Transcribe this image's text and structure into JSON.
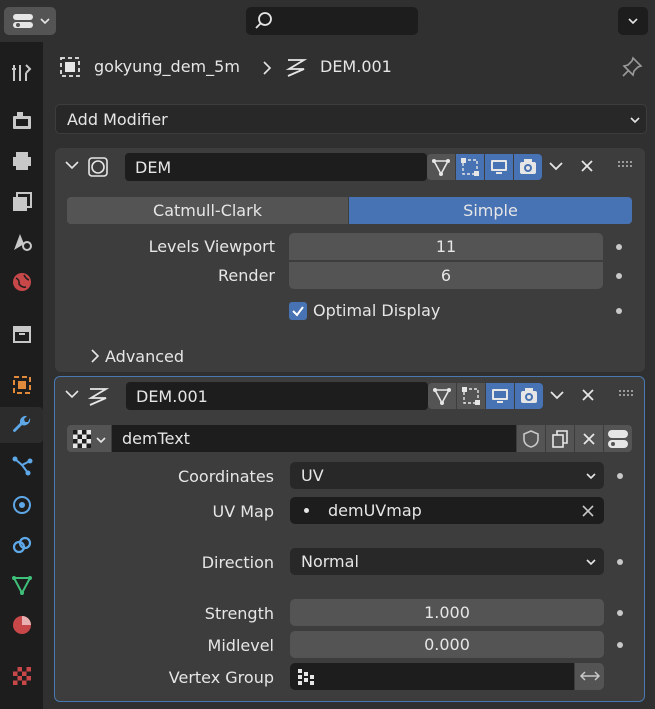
{
  "breadcrumb": {
    "object": "gokyung_dem_5m",
    "modifier": "DEM.001"
  },
  "add_modifier": {
    "label": "Add Modifier"
  },
  "modifiers": [
    {
      "name": "DEM",
      "algorithm": {
        "options": [
          "Catmull-Clark",
          "Simple"
        ],
        "selected": "Simple"
      },
      "levels_viewport": {
        "label": "Levels Viewport",
        "value": "11"
      },
      "render": {
        "label": "Render",
        "value": "6"
      },
      "optimal_display": {
        "label": "Optimal Display",
        "checked": true
      },
      "advanced": {
        "label": "Advanced"
      }
    },
    {
      "name": "DEM.001",
      "texture": {
        "name": "demText"
      },
      "coordinates": {
        "label": "Coordinates",
        "value": "UV"
      },
      "uv_map": {
        "label": "UV Map",
        "value": "demUVmap"
      },
      "direction": {
        "label": "Direction",
        "value": "Normal"
      },
      "strength": {
        "label": "Strength",
        "value": "1.000"
      },
      "midlevel": {
        "label": "Midlevel",
        "value": "0.000"
      },
      "vertex_group": {
        "label": "Vertex Group",
        "value": ""
      }
    }
  ],
  "colors": {
    "accent": "#4772b3",
    "panel": "#3d3d3d",
    "bg": "#303030",
    "field": "#545454",
    "dark": "#1d1d1d"
  }
}
